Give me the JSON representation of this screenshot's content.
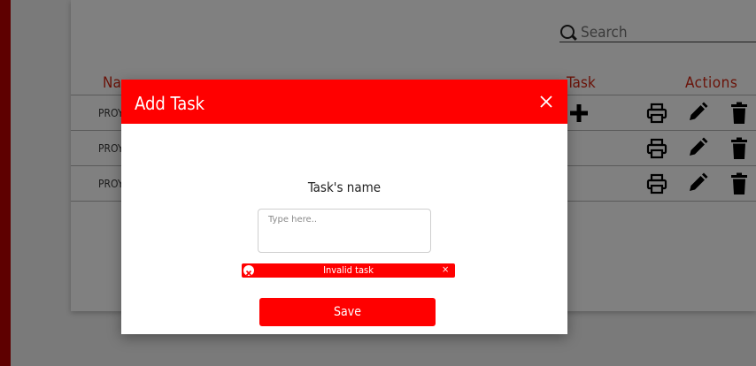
{
  "search": {
    "placeholder": "Search"
  },
  "table": {
    "headers": {
      "name": "Na",
      "task": "Task",
      "actions": "Actions"
    },
    "rows": [
      {
        "name": "PROY"
      },
      {
        "name": "PROY"
      },
      {
        "name": "PROY"
      }
    ]
  },
  "icons": {
    "search": "search-icon",
    "add": "plus-icon",
    "print": "printer-icon",
    "edit": "pencil-icon",
    "delete": "trash-icon",
    "close": "close-icon",
    "error": "error-circle-icon"
  },
  "modal": {
    "title": "Add Task",
    "field_label": "Task's name",
    "input_placeholder": "Type here..",
    "input_value": "",
    "error_text": "Invalid task",
    "error_close": "×",
    "save_label": "Save"
  },
  "colors": {
    "accent": "#ff0000",
    "overlay": "#7a7a7a",
    "header_text": "#6a1208"
  }
}
